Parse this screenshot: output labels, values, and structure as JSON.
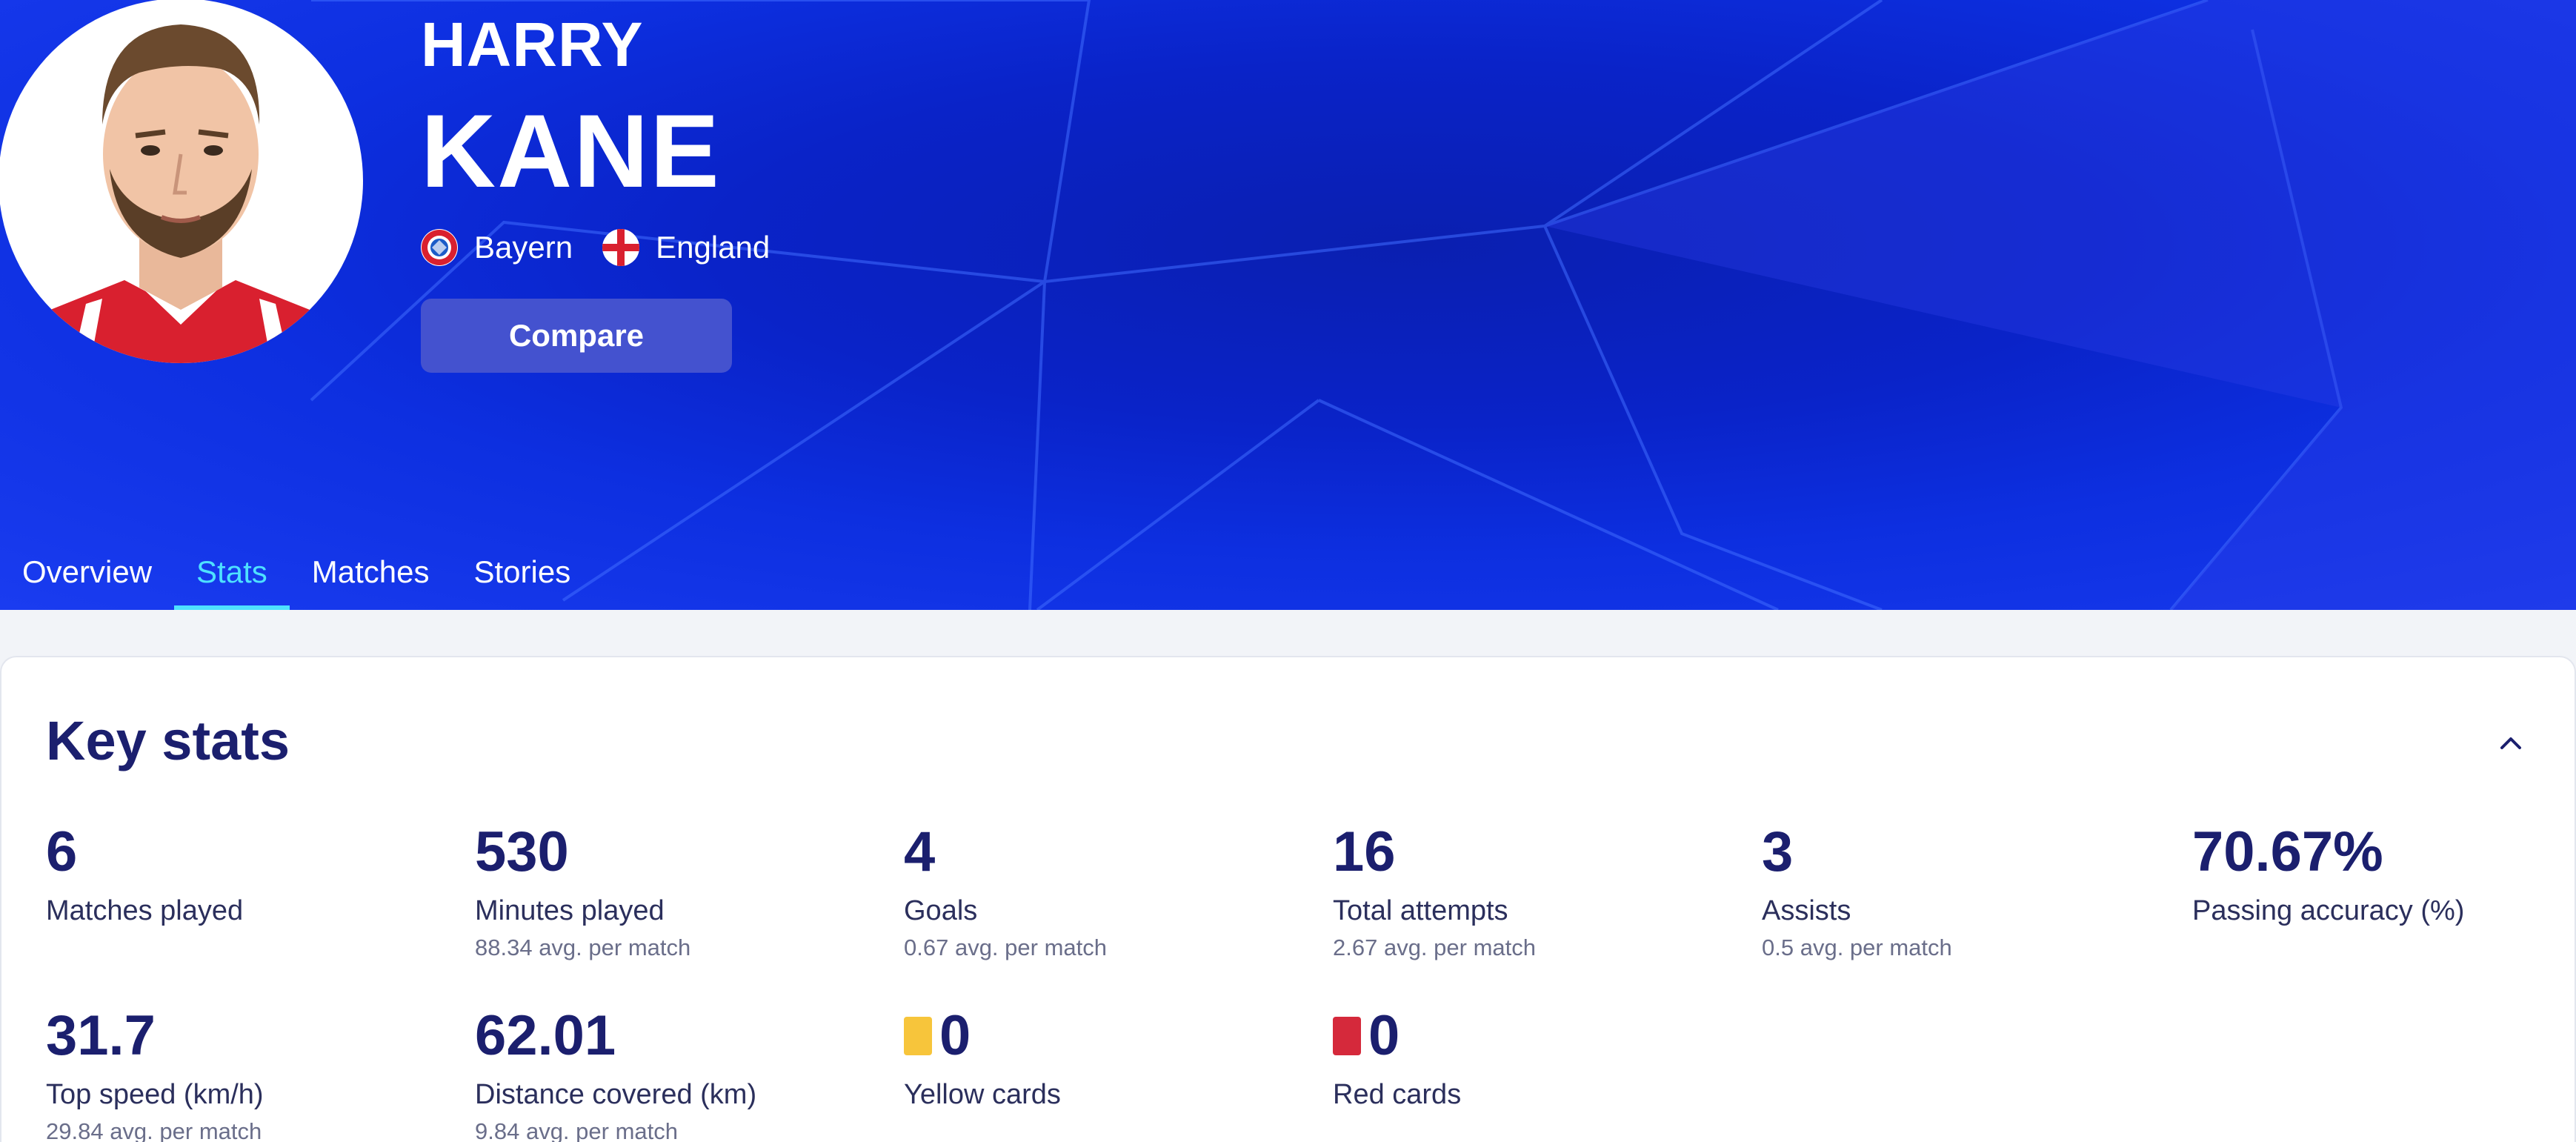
{
  "player": {
    "first_name": "HARRY",
    "last_name": "KANE",
    "club": "Bayern",
    "nation": "England",
    "compare_label": "Compare"
  },
  "tabs": [
    {
      "label": "Overview",
      "active": false
    },
    {
      "label": "Stats",
      "active": true
    },
    {
      "label": "Matches",
      "active": false
    },
    {
      "label": "Stories",
      "active": false
    }
  ],
  "key_stats": {
    "title": "Key stats",
    "stats": [
      {
        "value": "6",
        "label": "Matches played",
        "sub": ""
      },
      {
        "value": "530",
        "label": "Minutes played",
        "sub": "88.34 avg. per match"
      },
      {
        "value": "4",
        "label": "Goals",
        "sub": "0.67 avg. per match"
      },
      {
        "value": "16",
        "label": "Total attempts",
        "sub": "2.67 avg. per match"
      },
      {
        "value": "3",
        "label": "Assists",
        "sub": "0.5 avg. per match"
      },
      {
        "value": "70.67%",
        "label": "Passing accuracy (%)",
        "sub": ""
      },
      {
        "value": "31.7",
        "label": "Top speed (km/h)",
        "sub": "29.84 avg. per match"
      },
      {
        "value": "62.01",
        "label": "Distance covered (km)",
        "sub": "9.84 avg. per match"
      },
      {
        "value": "0",
        "label": "Yellow cards",
        "sub": ""
      },
      {
        "value": "0",
        "label": "Red cards",
        "sub": ""
      }
    ]
  },
  "colors": {
    "accent": "#4ee1ff",
    "hero_blue": "#0a23c8",
    "text_navy": "#1b1f6e",
    "yellow_card": "#f7c53b",
    "red_card": "#d5293b",
    "compare_button": "#4452cf"
  },
  "icons": {
    "club_badge": "bayern-badge-icon",
    "nation_flag": "england-flag-icon",
    "collapse": "chevron-up-icon",
    "yellow_card": "yellow-card-icon",
    "red_card": "red-card-icon"
  }
}
